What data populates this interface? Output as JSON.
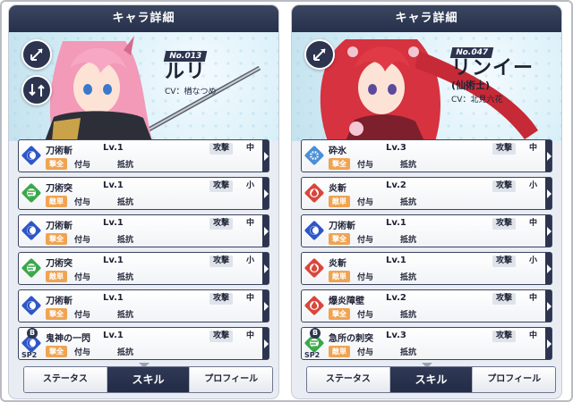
{
  "panels": [
    {
      "title": "キャラ詳細",
      "number": "No.013",
      "name": "ルリ",
      "class": "",
      "cv": "CV：楢なつめ",
      "skills": [
        {
          "icon": "blue-crescent",
          "icon_color": "#2e56c7",
          "name": "刀術斬",
          "lv": "Lv.1",
          "attr": "撃全",
          "attr_color": "#f0a452",
          "type": "攻撃",
          "size": "中",
          "effect1": "付与",
          "effect2": "抵抗",
          "sp": false
        },
        {
          "icon": "green-wind",
          "icon_color": "#3aa84a",
          "name": "刀術突",
          "lv": "Lv.1",
          "attr": "敵単",
          "attr_color": "#f0a452",
          "type": "攻撃",
          "size": "小",
          "effect1": "付与",
          "effect2": "抵抗",
          "sp": false
        },
        {
          "icon": "blue-crescent",
          "icon_color": "#2e56c7",
          "name": "刀術斬",
          "lv": "Lv.1",
          "attr": "撃全",
          "attr_color": "#f0a452",
          "type": "攻撃",
          "size": "中",
          "effect1": "付与",
          "effect2": "抵抗",
          "sp": false
        },
        {
          "icon": "green-wind",
          "icon_color": "#3aa84a",
          "name": "刀術突",
          "lv": "Lv.1",
          "attr": "敵単",
          "attr_color": "#f0a452",
          "type": "攻撃",
          "size": "小",
          "effect1": "付与",
          "effect2": "抵抗",
          "sp": false
        },
        {
          "icon": "blue-crescent",
          "icon_color": "#2e56c7",
          "name": "刀術斬",
          "lv": "Lv.1",
          "attr": "撃全",
          "attr_color": "#f0a452",
          "type": "攻撃",
          "size": "中",
          "effect1": "付与",
          "effect2": "抵抗",
          "sp": false
        },
        {
          "icon": "blue-crescent",
          "icon_color": "#2e56c7",
          "name": "鬼神の一閃",
          "lv": "Lv.1",
          "attr": "撃全",
          "attr_color": "#f0a452",
          "type": "攻撃",
          "size": "中",
          "effect1": "付与",
          "effect2": "抵抗",
          "sp": true,
          "sp_b": "B",
          "sp_label": "SP2"
        }
      ],
      "tabs": [
        "ステータス",
        "スキル",
        "プロフィール"
      ],
      "active_tab": 1
    },
    {
      "title": "キャラ詳細",
      "number": "No.047",
      "name": "リンイー",
      "class": "(仙術士)",
      "cv": "CV：北見六花",
      "skills": [
        {
          "icon": "ice-crystal",
          "icon_color": "#4a8fd8",
          "name": "砕氷",
          "lv": "Lv.3",
          "attr": "撃全",
          "attr_color": "#f0a452",
          "type": "攻撃",
          "size": "中",
          "effect1": "付与",
          "effect2": "抵抗",
          "sp": false
        },
        {
          "icon": "flame",
          "icon_color": "#d9463c",
          "name": "炎斬",
          "lv": "Lv.2",
          "attr": "敵単",
          "attr_color": "#f0a452",
          "type": "攻撃",
          "size": "小",
          "effect1": "付与",
          "effect2": "抵抗",
          "sp": false
        },
        {
          "icon": "blue-crescent",
          "icon_color": "#2e56c7",
          "name": "刀術斬",
          "lv": "Lv.1",
          "attr": "撃全",
          "attr_color": "#f0a452",
          "type": "攻撃",
          "size": "中",
          "effect1": "付与",
          "effect2": "抵抗",
          "sp": false
        },
        {
          "icon": "flame",
          "icon_color": "#d9463c",
          "name": "炎斬",
          "lv": "Lv.1",
          "attr": "敵単",
          "attr_color": "#f0a452",
          "type": "攻撃",
          "size": "小",
          "effect1": "付与",
          "effect2": "抵抗",
          "sp": false
        },
        {
          "icon": "flame",
          "icon_color": "#d9463c",
          "name": "爆炎障壁",
          "lv": "Lv.2",
          "attr": "撃全",
          "attr_color": "#f0a452",
          "type": "攻撃",
          "size": "中",
          "effect1": "付与",
          "effect2": "抵抗",
          "sp": false
        },
        {
          "icon": "green-wind",
          "icon_color": "#3aa84a",
          "name": "急所の刺突",
          "lv": "Lv.3",
          "attr": "敵単",
          "attr_color": "#f0a452",
          "type": "攻撃",
          "size": "中",
          "effect1": "付与",
          "effect2": "抵抗",
          "sp": true,
          "sp_b": "B",
          "sp_label": "SP2"
        }
      ],
      "tabs": [
        "ステータス",
        "スキル",
        "プロフィール"
      ],
      "active_tab": 1
    }
  ]
}
